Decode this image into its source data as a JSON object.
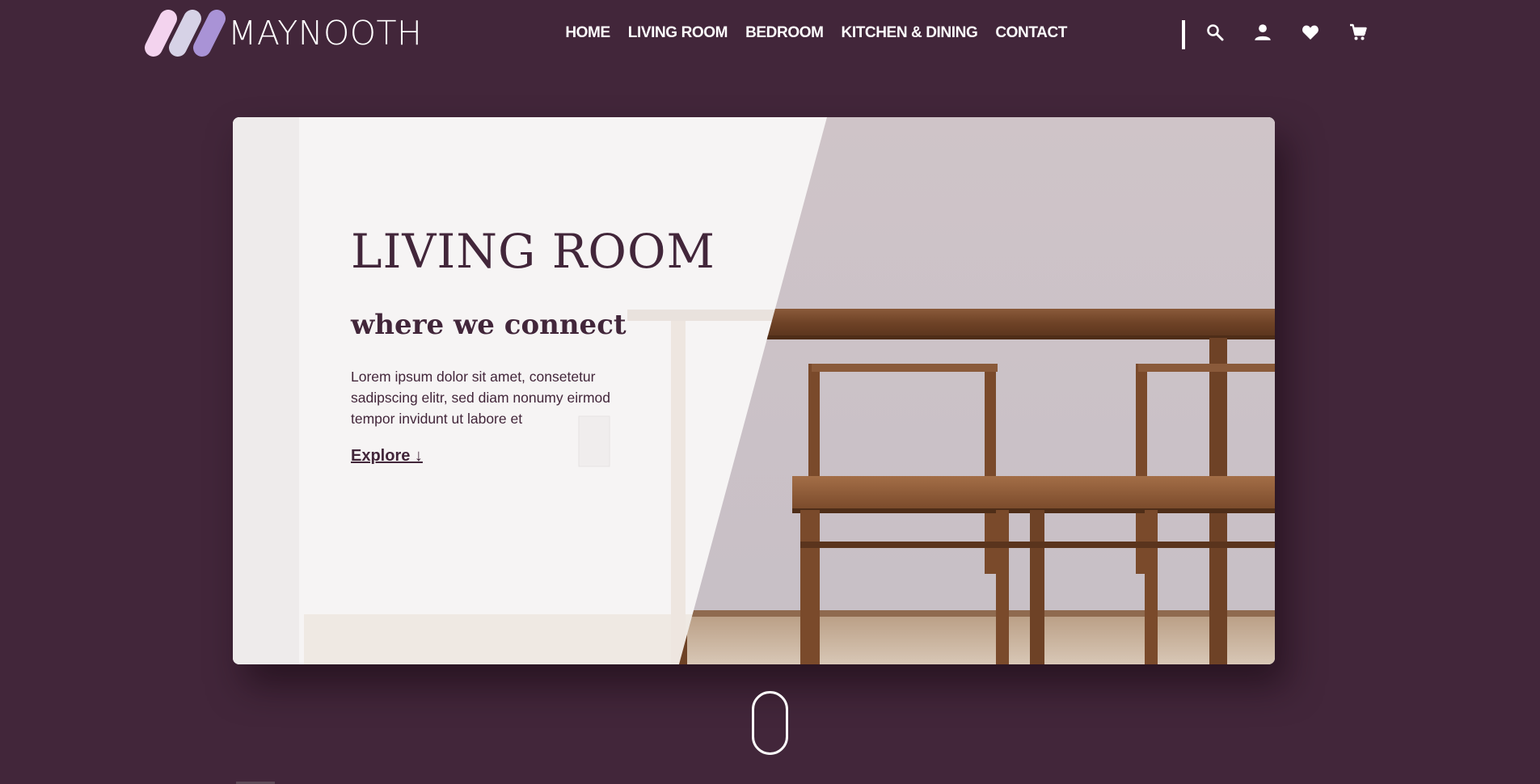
{
  "brand": {
    "name": "MAYNOOTH",
    "logo_icon": "three-stripes-logo",
    "colors": {
      "background": "#42263a",
      "stripe1": "#f3d3ee",
      "stripe2": "#d6d2e6",
      "stripe3": "#a993d6"
    }
  },
  "nav": {
    "items": [
      {
        "label": "HOME"
      },
      {
        "label": "LIVING ROOM"
      },
      {
        "label": "BEDROOM"
      },
      {
        "label": "KITCHEN & DINING"
      },
      {
        "label": "CONTACT"
      }
    ],
    "icons": [
      "search-icon",
      "user-icon",
      "heart-icon",
      "cart-icon"
    ]
  },
  "hero": {
    "title": "LIVING ROOM",
    "subtitle": "where we connect",
    "body": "Lorem ipsum dolor sit amet, consetetur sadipscing elitr, sed diam nonumy eirmod tempor invidunt ut labore et",
    "link_label": "Explore ↓",
    "text_color": "#42263a"
  }
}
